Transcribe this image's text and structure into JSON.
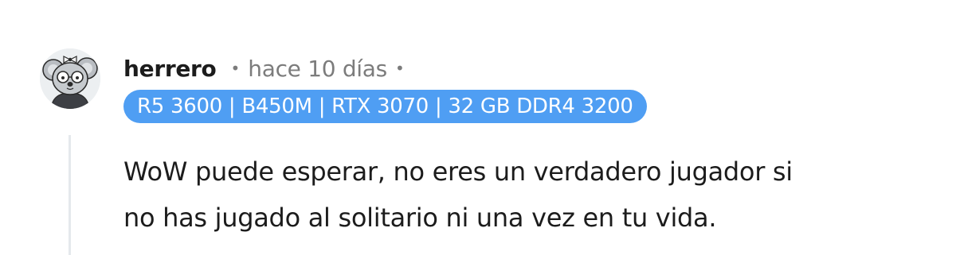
{
  "comment": {
    "username": "herrero",
    "separator": "•",
    "timestamp": "hace 10 días",
    "flair": "R5 3600 | B450M | RTX 3070 | 32 GB DDR4 3200",
    "body_lines": [
      "WoW puede esperar, no eres un verdadero jugador si",
      "no has jugado al solitario ni una vez en tu vida."
    ],
    "avatar_icon": "koala-avatar-icon"
  },
  "colors": {
    "flair_background": "#4f9ef3",
    "flair_text": "#ffffff",
    "username_text": "#1c1c1c",
    "meta_text": "#7c7c7c",
    "thread_line": "#e5e9ec"
  }
}
